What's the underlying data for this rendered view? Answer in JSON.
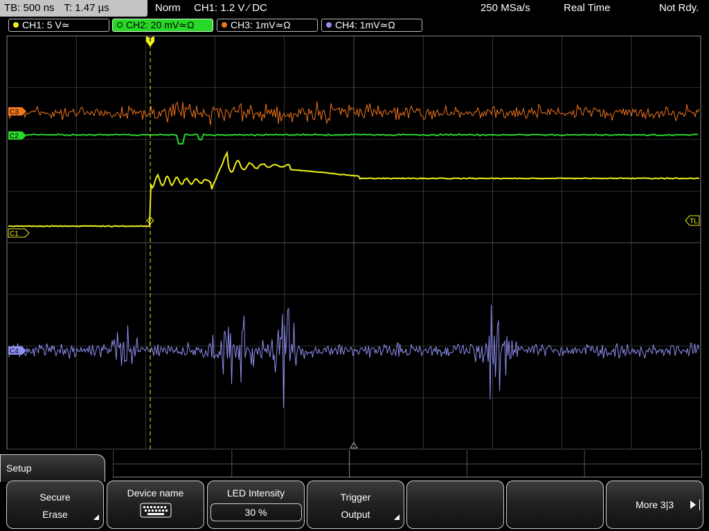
{
  "topbar": {
    "timebase": "TB: 500 ns",
    "trigger_time": "T: 1.47 µs",
    "mode": "Norm",
    "trigger_info": "CH1: 1.2 V ⁄ DC",
    "sample_rate": "250 MSa/s",
    "acq_mode": "Real Time",
    "state": "Not Rdy."
  },
  "channels": [
    {
      "label": "CH1: 5 V≃",
      "color": "#f2f21a",
      "active": false
    },
    {
      "label": "CH2: 20 mV≃Ω",
      "color": "#28d828",
      "active": true
    },
    {
      "label": "CH3: 1mV≃Ω",
      "color": "#f2761e",
      "active": false
    },
    {
      "label": "CH4: 1mV≃Ω",
      "color": "#8f8ff2",
      "active": false
    }
  ],
  "markers": {
    "trigger_top": "T",
    "trigger_level": "TL",
    "ch1": "C1",
    "ch2": "C2",
    "ch3": "C3",
    "ch4": "C4"
  },
  "setup_tab": "Setup",
  "softkeys": [
    {
      "line1": "Secure",
      "line2": "Erase",
      "corner": true
    },
    {
      "line1": "Device name",
      "icon": "keyboard-icon"
    },
    {
      "line1": "LED Intensity",
      "value": "30 %"
    },
    {
      "line1": "Trigger",
      "line2": "Output",
      "corner": true
    },
    {
      "line1": ""
    },
    {
      "line1": ""
    },
    {
      "line1": "More 3|3",
      "arrow": true
    }
  ],
  "colors": {
    "ch1": "#f2f21a",
    "ch2": "#28d828",
    "ch3": "#f2761e",
    "ch4": "#8f8ff2",
    "grid": "#5a5a5a"
  }
}
